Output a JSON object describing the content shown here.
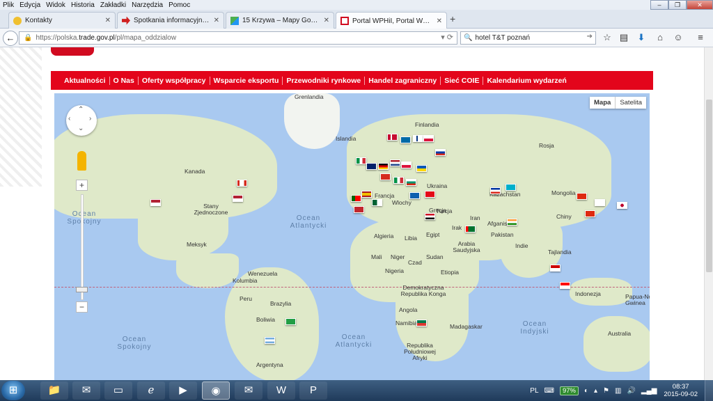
{
  "menubar": {
    "items": [
      "Plik",
      "Edycja",
      "Widok",
      "Historia",
      "Zakładki",
      "Narzędzia",
      "Pomoc"
    ]
  },
  "window": {
    "minimize": "–",
    "restore": "❐",
    "close": "✕"
  },
  "tabs": [
    {
      "label": "Kontakty",
      "icon": "contacts-icon"
    },
    {
      "label": "Spotkania informacyjne \"C...",
      "icon": "red-arrow-icon"
    },
    {
      "label": "15 Krzywa – Mapy Google",
      "icon": "google-maps-icon"
    },
    {
      "label": "Portal WPHiI, Portal WPHI, ...",
      "icon": "eagle-icon",
      "active": true
    }
  ],
  "newtab": "+",
  "navbar": {
    "url_prefix": "https://polska.",
    "url_domain": "trade.gov.pl",
    "url_path": "/pl/mapa_oddzialow",
    "search_value": "hotel T&T poznań"
  },
  "site_nav": {
    "items": [
      "Aktualności",
      "O Nas",
      "Oferty współpracy",
      "Wsparcie eksportu",
      "Przewodniki rynkowe",
      "Handel zagraniczny",
      "Sieć COIE",
      "Kalendarium wydarzeń"
    ]
  },
  "map": {
    "type_buttons": {
      "map": "Mapa",
      "satellite": "Satelita"
    },
    "zoom_in": "+",
    "zoom_out": "−",
    "labels": [
      "Grenlandia",
      "Islandia",
      "Finlandia",
      "Rosja",
      "Kanada",
      "Stany Zjednoczone",
      "Meksyk",
      "Ukraina",
      "Kazachstan",
      "Mongolia",
      "Chiny",
      "Afganistan",
      "Pakistan",
      "Indie",
      "Tajlandia",
      "Iran",
      "Irak",
      "Egipt",
      "Libia",
      "Algieria",
      "Mali",
      "Niger",
      "Czad",
      "Sudan",
      "Etiopia",
      "Nigeria",
      "Arabia Saudyjska",
      "Demokratyczna Republika Konga",
      "Angola",
      "Namibia",
      "Republika Południowej Afryki",
      "Madagaskar",
      "Wenezuela",
      "Kolumbia",
      "Peru",
      "Brazylia",
      "Boliwia",
      "Argentyna",
      "Indonezja",
      "Papua-Nowa Gwinea",
      "Australia",
      "Francja",
      "Wlochy",
      "Turcja",
      "Grecja"
    ],
    "oceans": [
      "Ocean Spokojny",
      "Ocean Atlantycki",
      "Ocean Atlantycki",
      "Ocean Indyjski",
      "Ocean Spokojny"
    ]
  },
  "taskbar": {
    "apps": [
      "folder-icon",
      "thunderbird-icon",
      "terminal-icon",
      "ie-icon",
      "media-icon",
      "firefox-icon",
      "email-icon",
      "word-icon",
      "powerpoint-icon"
    ],
    "lang": "PL",
    "battery": "97%",
    "time": "08:37",
    "date": "2015-09-02"
  },
  "colors": {
    "accent_red": "#e3051b",
    "map_water": "#a9c9f0",
    "map_land": "#dfe9c9"
  }
}
